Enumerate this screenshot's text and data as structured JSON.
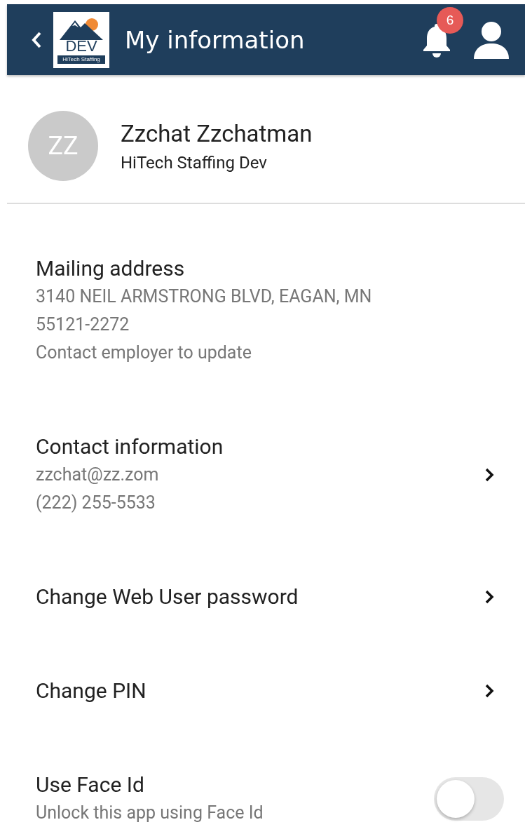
{
  "header": {
    "title": "My information",
    "logo": {
      "text": "DEV",
      "tagline": "HiTech Staffing"
    },
    "notification_count": "6"
  },
  "profile": {
    "initials": "ZZ",
    "name": "Zzchat Zzchatman",
    "company": "HiTech Staffing Dev"
  },
  "items": [
    {
      "kind": "info",
      "title": "Mailing address",
      "lines": [
        "3140 NEIL ARMSTRONG BLVD, EAGAN, MN 55121-2272",
        "Contact employer to update"
      ]
    },
    {
      "kind": "link",
      "title": "Contact information",
      "lines": [
        "zzchat@zz.zom",
        "(222) 255-5533"
      ]
    },
    {
      "kind": "link",
      "title": "Change Web User password"
    },
    {
      "kind": "link",
      "title": "Change PIN"
    },
    {
      "kind": "toggle",
      "title": "Use Face Id",
      "lines": [
        "Unlock this app using Face Id"
      ],
      "on": false
    }
  ]
}
